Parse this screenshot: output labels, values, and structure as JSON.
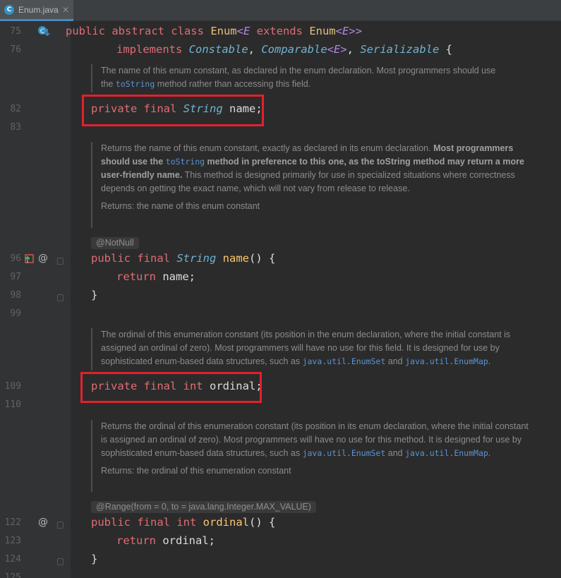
{
  "tab": {
    "label": "Enum.java",
    "close": "✕"
  },
  "lines": {
    "l75": "75",
    "l76": "76",
    "l82": "82",
    "l83": "83",
    "l96": "96",
    "l97": "97",
    "l98": "98",
    "l99": "99",
    "l109": "109",
    "l110": "110",
    "l122": "122",
    "l123": "123",
    "l124": "124",
    "l125": "125"
  },
  "code": {
    "decl_public": "public abstract class",
    "decl_enum": "Enum",
    "decl_e1": "<E",
    "decl_extends": " extends ",
    "decl_enum2": "Enum",
    "decl_e2": "<E>>",
    "impl_kw": "implements",
    "impl_constable": "Constable",
    "impl_comparable": "Comparable",
    "impl_e": "<E>",
    "impl_serializable": "Serializable",
    "impl_brace": "{",
    "field_name_mod": "private final",
    "field_name_type": "String",
    "field_name_id": "name;",
    "method_name_mod": "public final",
    "method_name_type": "String",
    "method_name_id": "name",
    "method_name_paren": "() {",
    "return_kw": "return",
    "return_name": "name;",
    "close_brace": "}",
    "field_ord_mod": "private final int",
    "field_ord_id": "ordinal;",
    "method_ord_mod": "public final int",
    "method_ord_id": "ordinal",
    "method_ord_paren": "() {",
    "return_ord": "ordinal;"
  },
  "docs": {
    "doc1_a": "The name of this enum constant, as declared in the enum declaration. Most programmers should use",
    "doc1_b_pre": "the ",
    "doc1_b_link": "toString",
    "doc1_b_post": " method rather than accessing this field.",
    "doc2_a": "Returns the name of this enum constant, exactly as declared in its enum declaration. ",
    "doc2_bold1": "Most programmers should use the ",
    "doc2_link": "toString",
    "doc2_bold2": " method in preference to this one, as the toString method may return a more user-friendly name.",
    "doc2_b": " This method is designed primarily for use in specialized situations where correctness depends on getting the exact name, which will not vary from release to release.",
    "doc2_returns": "Returns: the name of this enum constant",
    "doc3_a": "The ordinal of this enumeration constant (its position in the enum declaration, where the initial constant is assigned an ordinal of zero). Most programmers will have no use for this field. It is designed for use by sophisticated enum-based data structures, such as ",
    "doc3_link1": "java.util.EnumSet",
    "doc3_and": " and ",
    "doc3_link2": "java.util.EnumMap",
    "doc3_end": ".",
    "doc4_a": "Returns the ordinal of this enumeration constant (its position in its enum declaration, where the initial constant is assigned an ordinal of zero). Most programmers will have no use for this method. It is designed for use by sophisticated enum-based data structures, such as ",
    "doc4_link1": "java.util.EnumSet",
    "doc4_and": " and ",
    "doc4_link2": "java.util.EnumMap",
    "doc4_end": ".",
    "doc4_returns": "Returns: the ordinal of this enumeration constant"
  },
  "annotations": {
    "notnull": "@NotNull",
    "range": "@Range(from = 0, to = java.lang.Integer.MAX_VALUE)"
  },
  "gutter_icons": {
    "at": "@"
  },
  "colors": {
    "highlight_box": "#e4202d",
    "background": "#2b2b2b",
    "keyword": "#cc7832"
  }
}
